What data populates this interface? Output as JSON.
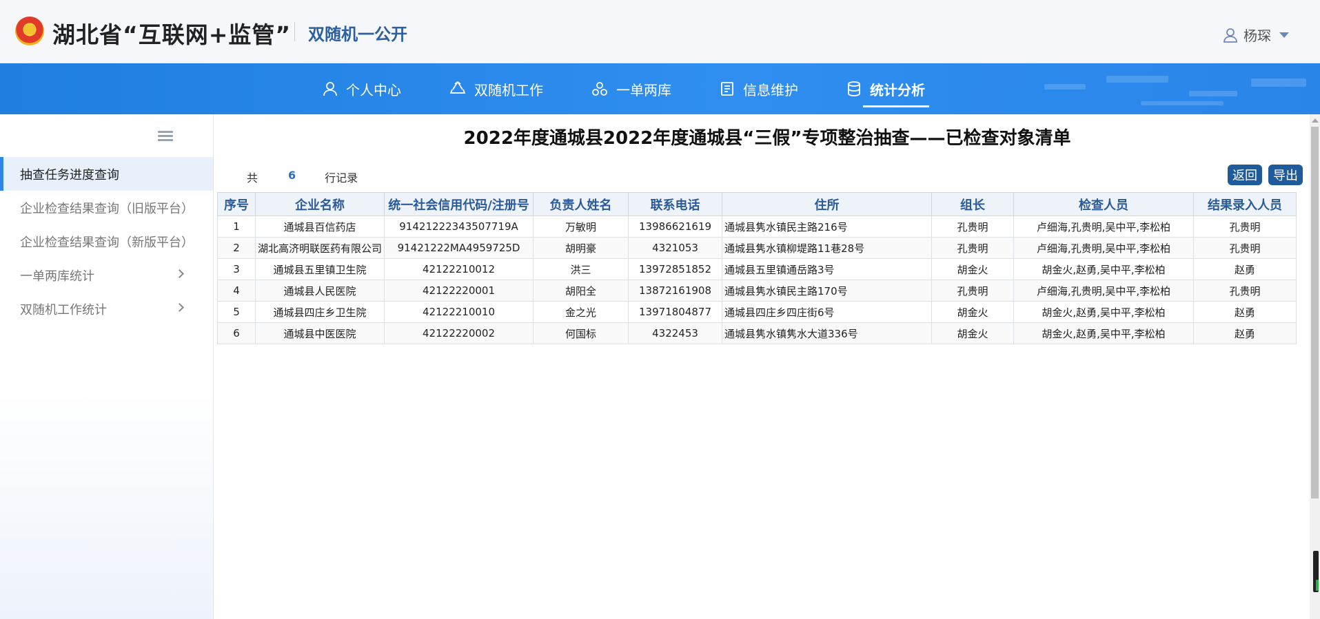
{
  "header": {
    "brand": "湖北省“互联网+监管”",
    "subtitle": "双随机一公开",
    "user_name": "杨琛"
  },
  "nav": {
    "items": [
      {
        "label": "个人中心",
        "icon": "person-icon",
        "active": false
      },
      {
        "label": "双随机工作",
        "icon": "recycle-icon",
        "active": false
      },
      {
        "label": "一单两库",
        "icon": "cluster-icon",
        "active": false
      },
      {
        "label": "信息维护",
        "icon": "document-icon",
        "active": false
      },
      {
        "label": "统计分析",
        "icon": "database-icon",
        "active": true
      }
    ]
  },
  "sidebar": {
    "items": [
      {
        "label": "抽查任务进度查询",
        "active": true,
        "has_children": false
      },
      {
        "label": "企业检查结果查询（旧版平台）",
        "active": false,
        "has_children": false
      },
      {
        "label": "企业检查结果查询（新版平台）",
        "active": false,
        "has_children": false
      },
      {
        "label": "一单两库统计",
        "active": false,
        "has_children": true
      },
      {
        "label": "双随机工作统计",
        "active": false,
        "has_children": true
      }
    ]
  },
  "main": {
    "title": "2022年度通城县2022年度通城县“三假”专项整治抽查——已检查对象清单",
    "record_prefix": "共",
    "record_count": "6",
    "record_suffix": "行记录",
    "back_label": "返回",
    "export_label": "导出"
  },
  "table": {
    "columns": [
      "序号",
      "企业名称",
      "统一社会信用代码/注册号",
      "负责人姓名",
      "联系电话",
      "住所",
      "组长",
      "检查人员",
      "结果录入人员"
    ],
    "rows": [
      [
        "1",
        "通城县百信药店",
        "91421222343507719A",
        "万敏明",
        "13986621619",
        "通城县隽水镇民主路216号",
        "孔贵明",
        "卢细海,孔贵明,吴中平,李松柏",
        "孔贵明"
      ],
      [
        "2",
        "湖北高济明联医药有限公司",
        "91421222MA4959725D",
        "胡明豪",
        "4321053",
        "通城县隽水镇柳堤路11巷28号",
        "孔贵明",
        "卢细海,孔贵明,吴中平,李松柏",
        "孔贵明"
      ],
      [
        "3",
        "通城县五里镇卫生院",
        "42122210012",
        "洪三",
        "13972851852",
        "通城县五里镇通岳路3号",
        "胡金火",
        "胡金火,赵勇,吴中平,李松柏",
        "赵勇"
      ],
      [
        "4",
        "通城县人民医院",
        "42122220001",
        "胡阳全",
        "13872161908",
        "通城县隽水镇民主路170号",
        "孔贵明",
        "卢细海,孔贵明,吴中平,李松柏",
        "孔贵明"
      ],
      [
        "5",
        "通城县四庄乡卫生院",
        "42122210010",
        "金之光",
        "13971804877",
        "通城县四庄乡四庄街6号",
        "胡金火",
        "胡金火,赵勇,吴中平,李松柏",
        "赵勇"
      ],
      [
        "6",
        "通城县中医医院",
        "42122220002",
        "何国标",
        "4322453",
        "通城县隽水镇隽水大道336号",
        "胡金火",
        "胡金火,赵勇,吴中平,李松柏",
        "赵勇"
      ]
    ]
  }
}
